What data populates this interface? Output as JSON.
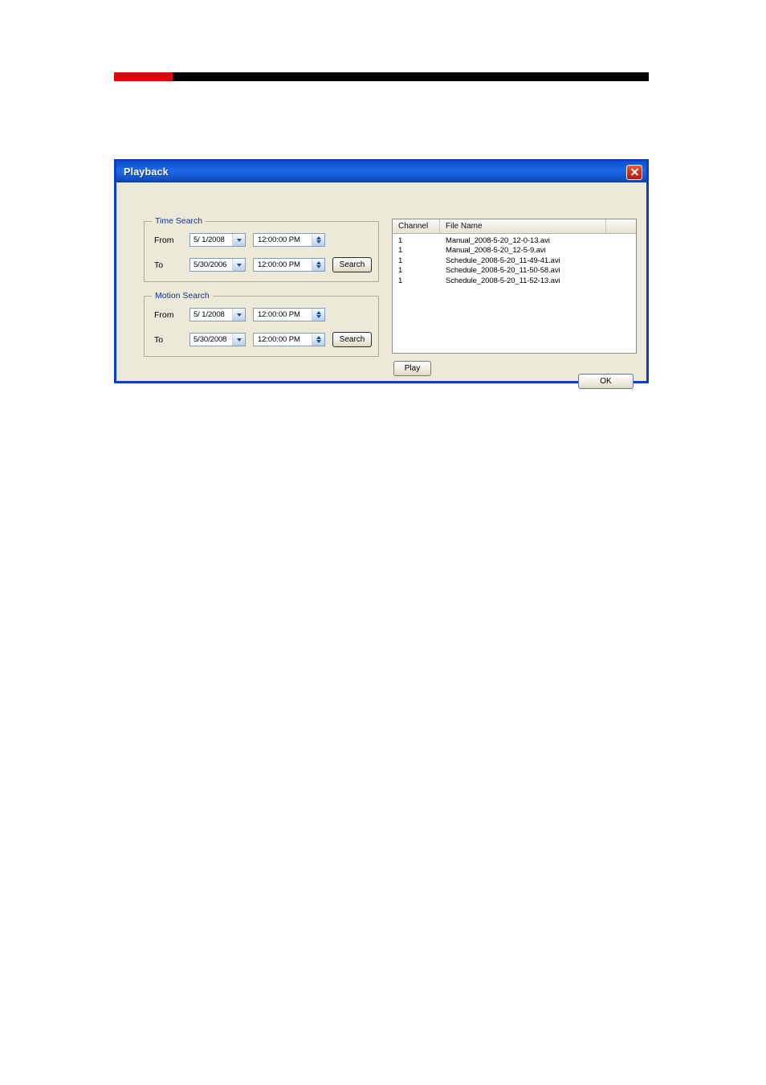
{
  "page": {
    "header_rule": {
      "accent_color": "#d60a0a",
      "bar_color": "#000000"
    }
  },
  "dialog": {
    "title": "Playback",
    "close_icon": "close-icon",
    "titlebar_color": "#1356c9",
    "body_color": "#ece9d8",
    "border_color": "#0a3fc4",
    "groups": [
      {
        "id": "time-search",
        "label": "Time Search",
        "rows": [
          {
            "label": "From",
            "date": "5/ 1/2008",
            "time": "12:00:00 PM",
            "dropdown_icon": "chevron-down-icon",
            "spinner_icon": "spinner-up-down-icon"
          },
          {
            "label": "To",
            "date": "5/30/2006",
            "time": "12:00:00 PM",
            "dropdown_icon": "chevron-down-icon",
            "spinner_icon": "spinner-up-down-icon",
            "button": "Search"
          }
        ]
      },
      {
        "id": "motion-search",
        "label": "Motion Search",
        "rows": [
          {
            "label": "From",
            "date": "5/ 1/2008",
            "time": "12:00:00 PM",
            "dropdown_icon": "chevron-down-icon",
            "spinner_icon": "spinner-up-down-icon"
          },
          {
            "label": "To",
            "date": "5/30/2008",
            "time": "12:00:00 PM",
            "dropdown_icon": "chevron-down-icon",
            "spinner_icon": "spinner-up-down-icon",
            "button": "Search"
          }
        ]
      }
    ],
    "file_list": {
      "columns": [
        "Channel",
        "File Name",
        ""
      ],
      "rows": [
        {
          "channel": "1",
          "filename": "Manual_2008-5-20_12-0-13.avi"
        },
        {
          "channel": "1",
          "filename": "Manual_2008-5-20_12-5-9.avi"
        },
        {
          "channel": "1",
          "filename": "Schedule_2008-5-20_11-49-41.avi"
        },
        {
          "channel": "1",
          "filename": "Schedule_2008-5-20_11-50-58.avi"
        },
        {
          "channel": "1",
          "filename": "Schedule_2008-5-20_11-52-13.avi"
        }
      ]
    },
    "buttons": {
      "play": "Play",
      "ok": "OK"
    }
  }
}
